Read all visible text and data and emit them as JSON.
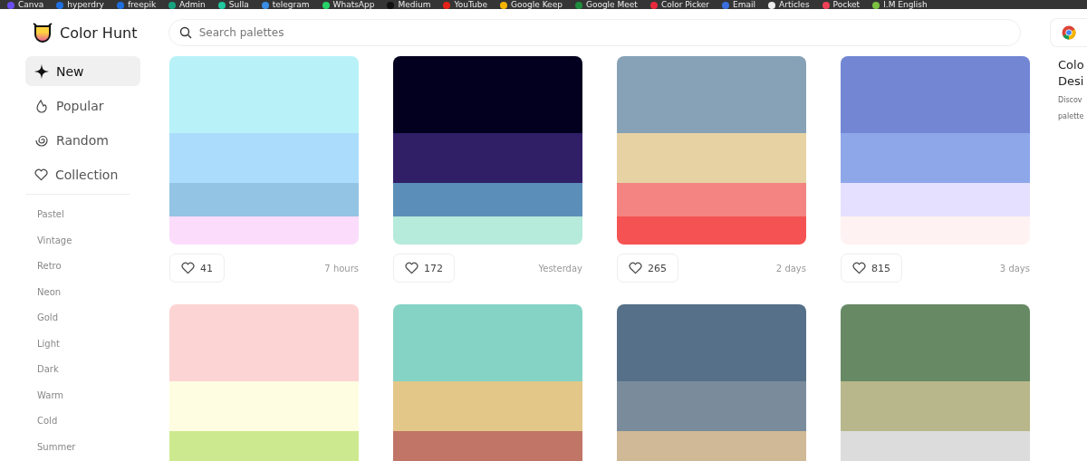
{
  "bookmarks": [
    {
      "label": "Canva",
      "color": "#6b4ff0"
    },
    {
      "label": "hyperdry",
      "color": "#1f6fe0"
    },
    {
      "label": "freepik",
      "color": "#1f6fe0"
    },
    {
      "label": "Admin",
      "color": "#16a37f"
    },
    {
      "label": "Sulla",
      "color": "#20c9a0"
    },
    {
      "label": "telegram",
      "color": "#3a8ee6"
    },
    {
      "label": "WhatsApp",
      "color": "#25d366"
    },
    {
      "label": "Medium",
      "color": "#111111"
    },
    {
      "label": "YouTube",
      "color": "#e62117"
    },
    {
      "label": "Google Keep",
      "color": "#f6b400"
    },
    {
      "label": "Google Meet",
      "color": "#1e8e3e"
    },
    {
      "label": "Color Picker",
      "color": "#e8283c"
    },
    {
      "label": "Email",
      "color": "#3b6fe0"
    },
    {
      "label": "Articles",
      "color": "#eeeeee"
    },
    {
      "label": "Pocket",
      "color": "#ef4056"
    },
    {
      "label": "I.M English",
      "color": "#7cc142"
    }
  ],
  "header": {
    "logo": "Color Hunt",
    "search": {
      "placeholder": "Search palettes"
    }
  },
  "sidebar": {
    "items": [
      {
        "label": "New",
        "kind": "new",
        "selected": true
      },
      {
        "label": "Popular",
        "kind": "popular",
        "selected": false
      },
      {
        "label": "Random",
        "kind": "random",
        "selected": false
      },
      {
        "label": "Collection",
        "kind": "collection",
        "selected": false
      }
    ],
    "tags": [
      "Pastel",
      "Vintage",
      "Retro",
      "Neon",
      "Gold",
      "Light",
      "Dark",
      "Warm",
      "Cold",
      "Summer"
    ]
  },
  "palettes": [
    {
      "swatches": [
        {
          "color": "#b8f2f8"
        },
        {
          "color": "#acdcfb"
        },
        {
          "color": "#94c4e4"
        },
        {
          "color": "#fbdcfb"
        }
      ],
      "likes": "41",
      "time": "7 hours"
    },
    {
      "swatches": [
        {
          "color": "#03001f"
        },
        {
          "color": "#301e67"
        },
        {
          "color": "#5b8fb9"
        },
        {
          "color": "#b6eada"
        }
      ],
      "likes": "172",
      "time": "Yesterday"
    },
    {
      "swatches": [
        {
          "color": "#87a2b6"
        },
        {
          "color": "#e7d2a4"
        },
        {
          "color": "#f38482"
        },
        {
          "color": "#f55353"
        }
      ],
      "likes": "265",
      "time": "2 days"
    },
    {
      "swatches": [
        {
          "color": "#7286d3"
        },
        {
          "color": "#8ea7e9"
        },
        {
          "color": "#e5e0ff"
        },
        {
          "color": "#fff2f2"
        }
      ],
      "likes": "815",
      "time": "3 days"
    },
    {
      "swatches": [
        {
          "color": "#fdd4d4"
        },
        {
          "color": "#fefde2"
        },
        {
          "color": "#cde990"
        }
      ]
    },
    {
      "swatches": [
        {
          "color": "#85d3c5"
        },
        {
          "color": "#e3c789"
        },
        {
          "color": "#c07566"
        }
      ]
    },
    {
      "swatches": [
        {
          "color": "#557088"
        },
        {
          "color": "#7a8c9c"
        },
        {
          "color": "#cfb996"
        }
      ]
    },
    {
      "swatches": [
        {
          "color": "#678a65"
        },
        {
          "color": "#b8b78b"
        },
        {
          "color": "#dcdcdc"
        }
      ]
    }
  ],
  "promo": {
    "title_lines": [
      "Colo",
      "Desi"
    ],
    "text_lines": [
      "Discov",
      "palette"
    ]
  }
}
